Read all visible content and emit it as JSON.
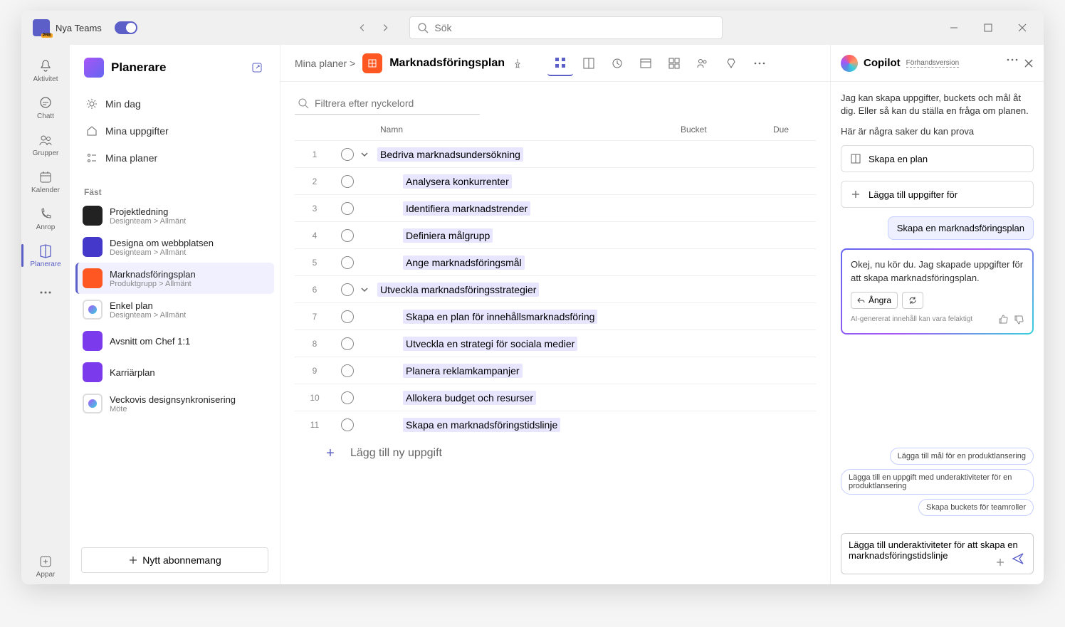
{
  "titlebar": {
    "app_name": "Nya Teams",
    "search_placeholder": "Sök"
  },
  "rail": [
    {
      "label": "Aktivitet"
    },
    {
      "label": "Chatt"
    },
    {
      "label": "Grupper"
    },
    {
      "label": "Kalender"
    },
    {
      "label": "Anrop"
    },
    {
      "label": "Planerare"
    },
    {
      "label": "Appar"
    }
  ],
  "leftpanel": {
    "title": "Planerare",
    "nav": [
      {
        "label": "Min dag"
      },
      {
        "label": "Mina uppgifter"
      },
      {
        "label": "Mina planer"
      }
    ],
    "section": "Fäst",
    "pinned": [
      {
        "title": "Projektledning",
        "sub": "Designteam > Allmänt",
        "color": "#222"
      },
      {
        "title": "Designa om webbplatsen",
        "sub": "Designteam > Allmänt",
        "color": "#4338ca"
      },
      {
        "title": "Marknadsföringsplan",
        "sub": "Produktgrupp > Allmänt",
        "color": "#ff5722",
        "selected": true
      },
      {
        "title": "Enkel plan",
        "sub": "Designteam > Allmänt",
        "color": "#ffffff",
        "ring": true
      },
      {
        "title": "Avsnitt om Chef 1:1",
        "sub": "",
        "color": "#7c3aed"
      },
      {
        "title": "Karriärplan",
        "sub": "",
        "color": "#7c3aed"
      },
      {
        "title": "Veckovis designsynkronisering",
        "sub": "Möte",
        "color": "#ffffff",
        "ring": true
      }
    ],
    "new_button": "Nytt abonnemang"
  },
  "main": {
    "breadcrumb": "Mina planer >",
    "plan_name": "Marknadsföringsplan",
    "filter_placeholder": "Filtrera efter nyckelord",
    "headers": {
      "name": "Namn",
      "bucket": "Bucket",
      "due": "Due"
    },
    "tasks": [
      {
        "n": 1,
        "name": "Bedriva marknadsundersökning",
        "expandable": true
      },
      {
        "n": 2,
        "name": "Analysera konkurrenter",
        "sub": true
      },
      {
        "n": 3,
        "name": "Identifiera marknadstrender",
        "sub": true
      },
      {
        "n": 4,
        "name": "Definiera målgrupp",
        "sub": true
      },
      {
        "n": 5,
        "name": "Ange marknadsföringsmål",
        "sub": true
      },
      {
        "n": 6,
        "name": "Utveckla marknadsföringsstrategier",
        "expandable": true
      },
      {
        "n": 7,
        "name": "Skapa en plan för innehållsmarknadsföring",
        "sub": true
      },
      {
        "n": 8,
        "name": "Utveckla en strategi för sociala medier",
        "sub": true
      },
      {
        "n": 9,
        "name": "Planera reklamkampanjer",
        "sub": true
      },
      {
        "n": 10,
        "name": "Allokera budget och resurser",
        "sub": true
      },
      {
        "n": 11,
        "name": "Skapa en marknadsföringstidslinje",
        "sub": true
      }
    ],
    "add_task": "Lägg till ny uppgift"
  },
  "copilot": {
    "title": "Copilot",
    "badge": "Förhandsversion",
    "intro": "Jag kan skapa uppgifter, buckets och mål åt dig. Eller så kan du ställa en fråga om planen.",
    "try_label": "Här är några saker du kan prova",
    "suggestions": [
      "Skapa en plan",
      "Lägga till uppgifter för"
    ],
    "user_message": "Skapa en marknadsföringsplan",
    "ai_response": "Okej, nu kör du. Jag skapade uppgifter för att skapa marknadsföringsplan.",
    "undo": "Ångra",
    "disclaimer": "AI-genererat innehåll kan vara felaktigt",
    "pills": [
      "Lägga till mål för en produktlansering",
      "Lägga till en uppgift med underaktiviteter för en produktlansering",
      "Skapa buckets för teamroller"
    ],
    "input_value": "Lägga till underaktiviteter för att skapa en marknadsföringstidslinje"
  }
}
